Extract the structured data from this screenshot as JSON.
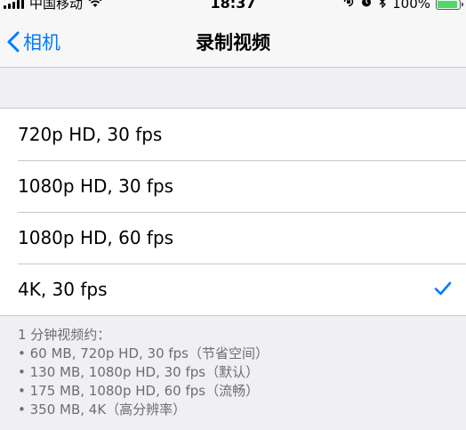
{
  "status_bar": {
    "carrier": "中国移动",
    "time": "18:37",
    "battery": "100%",
    "battery_level": 1.0,
    "icons": [
      "signal-icon",
      "wifi-icon",
      "orientation-lock-icon",
      "alarm-icon",
      "bluetooth-icon",
      "battery-icon"
    ]
  },
  "nav": {
    "back_label": "相机",
    "title": "录制视频"
  },
  "options": [
    {
      "label": "720p HD, 30 fps",
      "selected": false
    },
    {
      "label": "1080p HD, 30 fps",
      "selected": false
    },
    {
      "label": "1080p HD, 60 fps",
      "selected": false
    },
    {
      "label": "4K, 30 fps",
      "selected": true
    }
  ],
  "footer": {
    "heading": "1 分钟视频约：",
    "lines": [
      "• 60 MB, 720p HD, 30 fps（节省空间）",
      "• 130 MB, 1080p HD, 30 fps（默认）",
      "• 175 MB, 1080p HD, 60 fps（流畅）",
      "• 350 MB, 4K（高分辨率）"
    ]
  },
  "colors": {
    "accent": "#007aff",
    "background": "#efeff4",
    "battery_fill": "#4cd964",
    "footer_text": "#6d6d72"
  }
}
